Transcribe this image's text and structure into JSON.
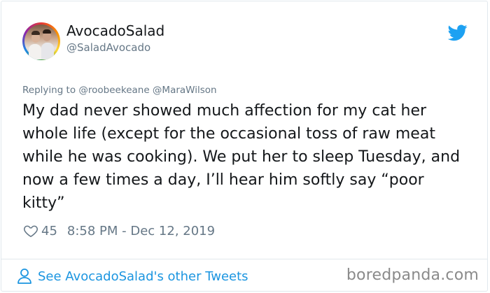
{
  "author": {
    "display_name": "AvocadoSalad",
    "handle": "@SaladAvocado"
  },
  "icons": {
    "platform": "twitter-bird-icon",
    "like": "heart-icon",
    "profile": "user-icon"
  },
  "reply": {
    "prefix": "Replying to",
    "mentions": "@roobeekeane @MaraWilson"
  },
  "tweet": {
    "text": "My dad never showed much affection for my cat her whole life (except for the occasional toss of raw meat while he was cooking). We put her to sleep Tuesday, and now a few times a day, I’ll hear him softly say “poor kitty”"
  },
  "stats": {
    "likes": "45",
    "timestamp": "8:58 PM - Dec 12, 2019"
  },
  "footer": {
    "see_more_label": "See AvocadoSalad's other Tweets",
    "watermark": "boredpanda.com"
  },
  "colors": {
    "link": "#1b95e0",
    "secondary_text": "#657786",
    "twitter_blue": "#1da1f2"
  }
}
